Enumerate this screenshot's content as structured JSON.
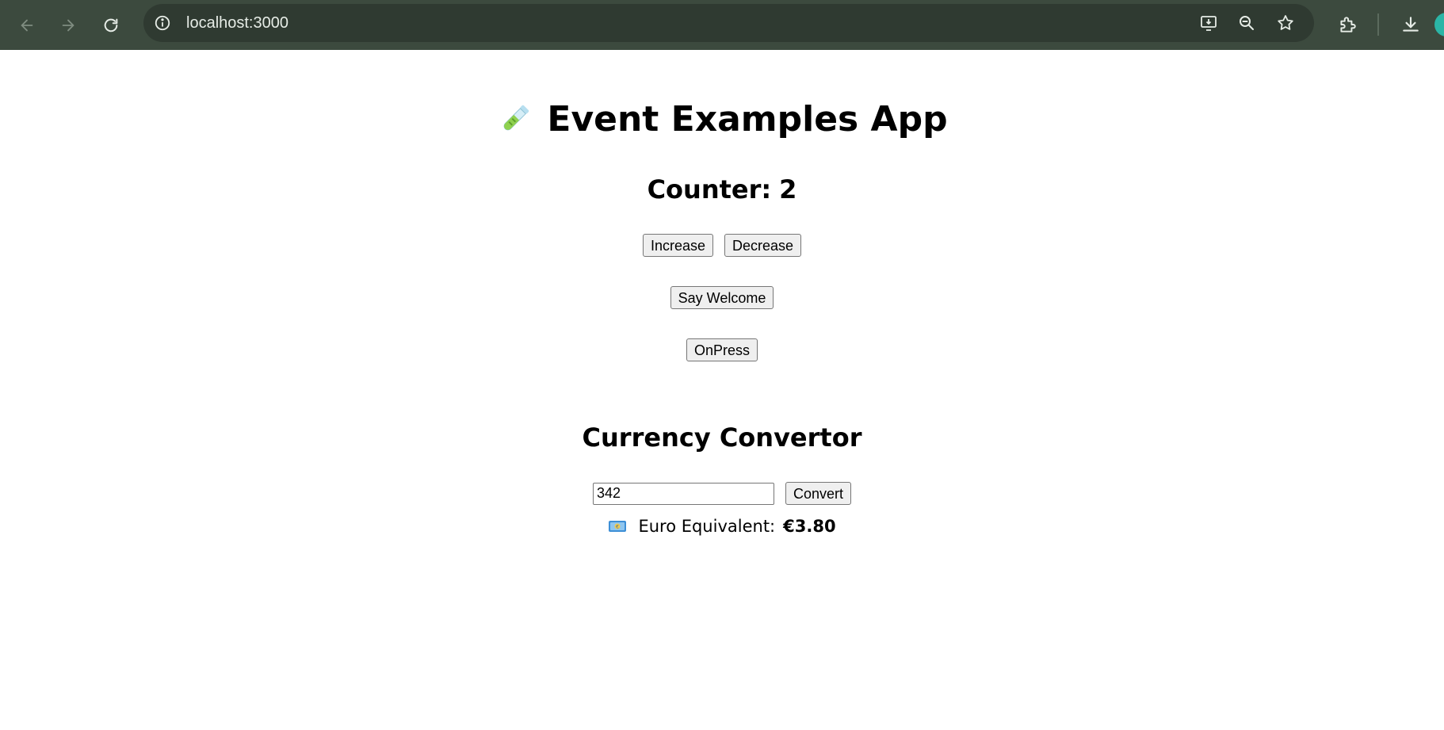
{
  "browser": {
    "url": "localhost:3000"
  },
  "page": {
    "title": "Event Examples App",
    "title_icon": "test-tube-icon",
    "counter": {
      "label": "Counter:",
      "value": 2,
      "increase_label": "Increase",
      "decrease_label": "Decrease"
    },
    "welcome_button_label": "Say Welcome",
    "onpress_button_label": "OnPress",
    "currency": {
      "heading": "Currency Convertor",
      "input_value": "342",
      "convert_label": "Convert",
      "result_icon": "euro-banknote-icon",
      "result_label": "Euro Equivalent:",
      "result_value": "€3.80"
    }
  },
  "colors": {
    "browser_bar": "#3c4a3e",
    "omnibox": "#2f3a31",
    "profile": "#2bb5a6"
  }
}
